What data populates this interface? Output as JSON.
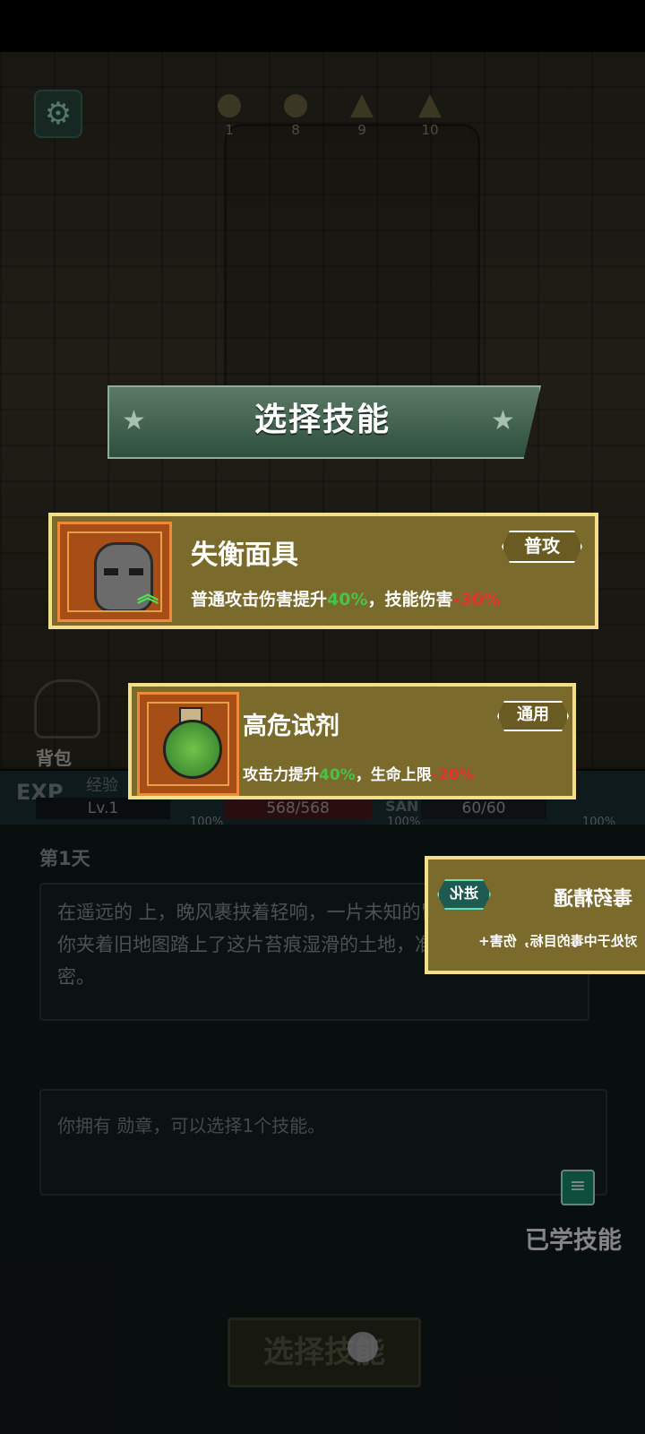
{
  "hud": {
    "settings_icon": "gear-icon",
    "markers": [
      {
        "icon": "coin-icon",
        "value": "1"
      },
      {
        "icon": "exclamation-circle-icon",
        "value": "8"
      },
      {
        "icon": "warning-triangle-icon",
        "value": "9"
      },
      {
        "icon": "warning-triangle-icon",
        "value": "10"
      }
    ]
  },
  "banner": {
    "title": "选择技能"
  },
  "skills": [
    {
      "name": "失衡面具",
      "tag": "普攻",
      "desc_prefix": "普通攻击伤害提升",
      "desc_up": "40%",
      "desc_mid": "，技能伤害",
      "desc_down": "-30%",
      "icon": "mask-icon",
      "tag_color": "#6a5b22"
    },
    {
      "name": "高危试剂",
      "tag": "通用",
      "desc_prefix": "攻击力提升",
      "desc_up": "40%",
      "desc_mid": "，生命上限",
      "desc_down": "-20%",
      "icon": "potion-icon",
      "tag_color": "#6a5b22"
    },
    {
      "name": "毒药精通",
      "tag": "进化",
      "desc": "对处于中毒的目标，伤害+",
      "tag_color": "#1c5a52"
    }
  ],
  "status": {
    "bag_label": "背包",
    "exp_short": "EXP",
    "exp_label": "经验",
    "level": "Lv.1",
    "exp_pct": "100%",
    "hp": "568/568",
    "hp_pct": "100%",
    "san_label": "SAN",
    "san": "60/60",
    "san_pct": "100%"
  },
  "story": {
    "day": "第1天",
    "text": "在遥远的 上，晚风裹挟着轻响，一片未知的冒险正等待着你。你夹着旧地图踏上了这片苔痕湿滑的土地，准备揭开它的秘密。",
    "info": "你拥有 勋章，可以选择1个技能。"
  },
  "learned_skills_label": "已学技能",
  "choose_button_label": "选择技能",
  "colors": {
    "up": "#49c24a",
    "down": "#e0352c",
    "card_bg": "#7a6a2c",
    "card_border": "#f3df8a"
  }
}
